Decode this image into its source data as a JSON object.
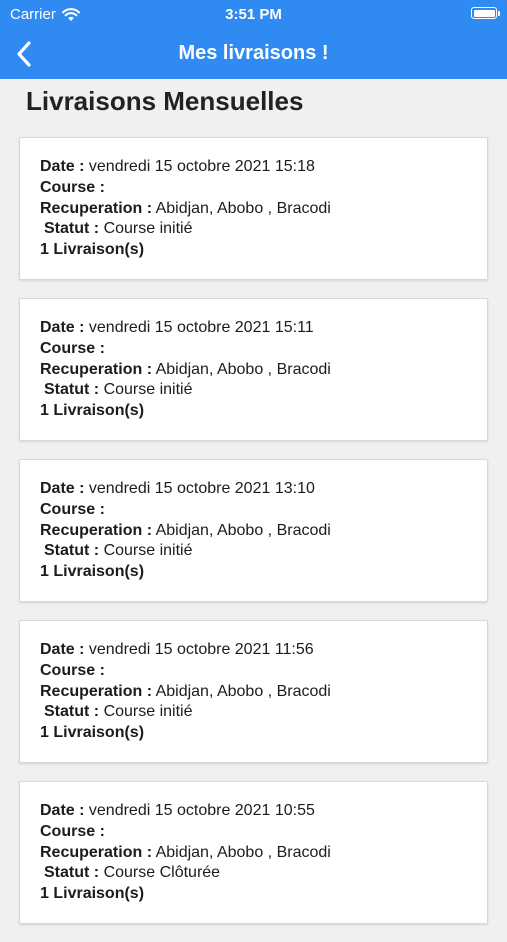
{
  "status_bar": {
    "carrier": "Carrier",
    "time": "3:51 PM"
  },
  "nav": {
    "title": "Mes livraisons !",
    "back_icon": "chevron-left-icon",
    "color": "#2f8af2"
  },
  "section_title": "Livraisons Mensuelles",
  "labels": {
    "date": "Date :",
    "course": "Course :",
    "recuperation": "Recuperation :",
    "statut": "Statut :"
  },
  "deliveries": [
    {
      "date": "vendredi 15 octobre 2021 15:18",
      "course": "",
      "recuperation": "Abidjan, Abobo , Bracodi",
      "statut": "Course initié",
      "count": "1 Livraison(s)"
    },
    {
      "date": "vendredi 15 octobre 2021 15:11",
      "course": "",
      "recuperation": "Abidjan, Abobo , Bracodi",
      "statut": "Course initié",
      "count": "1 Livraison(s)"
    },
    {
      "date": "vendredi 15 octobre 2021 13:10",
      "course": "",
      "recuperation": "Abidjan, Abobo , Bracodi",
      "statut": "Course initié",
      "count": "1 Livraison(s)"
    },
    {
      "date": "vendredi 15 octobre 2021 11:56",
      "course": "",
      "recuperation": "Abidjan, Abobo , Bracodi",
      "statut": "Course initié",
      "count": "1 Livraison(s)"
    },
    {
      "date": "vendredi 15 octobre 2021 10:55",
      "course": "",
      "recuperation": "Abidjan, Abobo , Bracodi",
      "statut": "Course Clôturée",
      "count": "1 Livraison(s)"
    }
  ]
}
